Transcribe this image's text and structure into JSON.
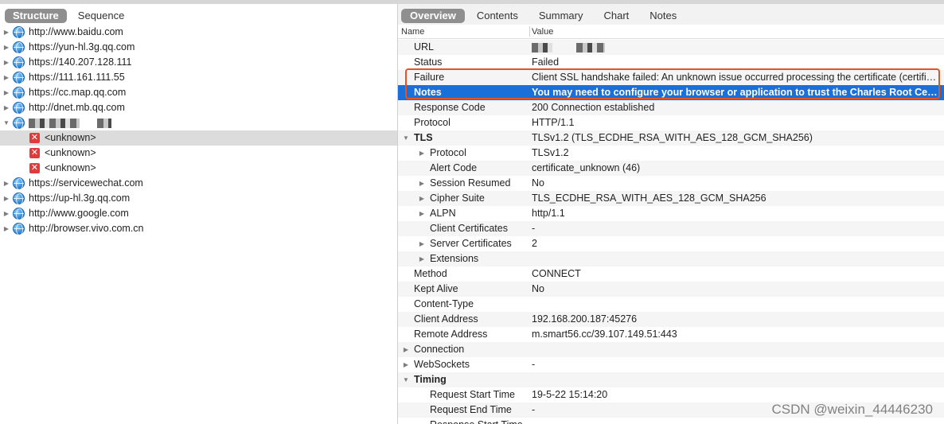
{
  "left_tabs": [
    {
      "label": "Structure",
      "active": true
    },
    {
      "label": "Sequence",
      "active": false
    }
  ],
  "tree": [
    {
      "label": "http://www.baidu.com",
      "expanded": false
    },
    {
      "label": "https://yun-hl.3g.qq.com",
      "expanded": false
    },
    {
      "label": "https://140.207.128.111",
      "expanded": false
    },
    {
      "label": "https://111.161.111.55",
      "expanded": false
    },
    {
      "label": "https://cc.map.qq.com",
      "expanded": false
    },
    {
      "label": "http://dnet.mb.qq.com",
      "expanded": false
    },
    {
      "label": "",
      "expanded": true,
      "redacted": true,
      "children": [
        {
          "label": "<unknown>",
          "selected": true
        },
        {
          "label": "<unknown>",
          "selected": false
        },
        {
          "label": "<unknown>",
          "selected": false
        }
      ]
    },
    {
      "label": "https://servicewechat.com",
      "expanded": false
    },
    {
      "label": "https://up-hl.3g.qq.com",
      "expanded": false
    },
    {
      "label": "http://www.google.com",
      "expanded": false
    },
    {
      "label": "http://browser.vivo.com.cn",
      "expanded": false
    }
  ],
  "right_tabs": [
    {
      "label": "Overview",
      "active": true
    },
    {
      "label": "Contents",
      "active": false
    },
    {
      "label": "Summary",
      "active": false
    },
    {
      "label": "Chart",
      "active": false
    },
    {
      "label": "Notes",
      "active": false
    }
  ],
  "columns": {
    "name": "Name",
    "value": "Value"
  },
  "properties": [
    {
      "name": "URL",
      "value": "",
      "level": 0,
      "redacted": true
    },
    {
      "name": "Status",
      "value": "Failed",
      "level": 0
    },
    {
      "name": "Failure",
      "value": "Client SSL handshake failed: An unknown issue occurred processing the certificate (certificate_unknown)",
      "level": 0
    },
    {
      "name": "Notes",
      "value": "You may need to configure your browser or application to trust the Charles Root Certificate. See SSL Proxying in the Help menu.",
      "level": 0,
      "selected": true,
      "bold": true
    },
    {
      "name": "Response Code",
      "value": "200 Connection established",
      "level": 0
    },
    {
      "name": "Protocol",
      "value": "HTTP/1.1",
      "level": 0
    },
    {
      "name": "TLS",
      "value": "TLSv1.2 (TLS_ECDHE_RSA_WITH_AES_128_GCM_SHA256)",
      "level": 0,
      "toggle": "open",
      "bold": true
    },
    {
      "name": "Protocol",
      "value": "TLSv1.2",
      "level": 1,
      "toggle": "closed"
    },
    {
      "name": "Alert Code",
      "value": "certificate_unknown (46)",
      "level": 1
    },
    {
      "name": "Session Resumed",
      "value": "No",
      "level": 1,
      "toggle": "closed"
    },
    {
      "name": "Cipher Suite",
      "value": "TLS_ECDHE_RSA_WITH_AES_128_GCM_SHA256",
      "level": 1,
      "toggle": "closed"
    },
    {
      "name": "ALPN",
      "value": "http/1.1",
      "level": 1,
      "toggle": "closed"
    },
    {
      "name": "Client Certificates",
      "value": "-",
      "level": 1
    },
    {
      "name": "Server Certificates",
      "value": "2",
      "level": 1,
      "toggle": "closed"
    },
    {
      "name": "Extensions",
      "value": "",
      "level": 1,
      "toggle": "closed"
    },
    {
      "name": "Method",
      "value": "CONNECT",
      "level": 0
    },
    {
      "name": "Kept Alive",
      "value": "No",
      "level": 0
    },
    {
      "name": "Content-Type",
      "value": "",
      "level": 0
    },
    {
      "name": "Client Address",
      "value": "192.168.200.187:45276",
      "level": 0
    },
    {
      "name": "Remote Address",
      "value": "m.smart56.cc/39.107.149.51:443",
      "level": 0
    },
    {
      "name": "Connection",
      "value": "",
      "level": 0,
      "toggle": "closed"
    },
    {
      "name": "WebSockets",
      "value": "-",
      "level": 0,
      "toggle": "closed"
    },
    {
      "name": "Timing",
      "value": "",
      "level": 0,
      "toggle": "open",
      "bold": true
    },
    {
      "name": "Request Start Time",
      "value": "19-5-22 15:14:20",
      "level": 1
    },
    {
      "name": "Request End Time",
      "value": "-",
      "level": 1
    },
    {
      "name": "Response Start Time",
      "value": "-",
      "level": 1
    }
  ],
  "watermark": "CSDN @weixin_44446230",
  "colors": {
    "selection": "#1a6fd8",
    "highlight_box": "#e0542a",
    "active_tab": "#8f8f8f"
  }
}
